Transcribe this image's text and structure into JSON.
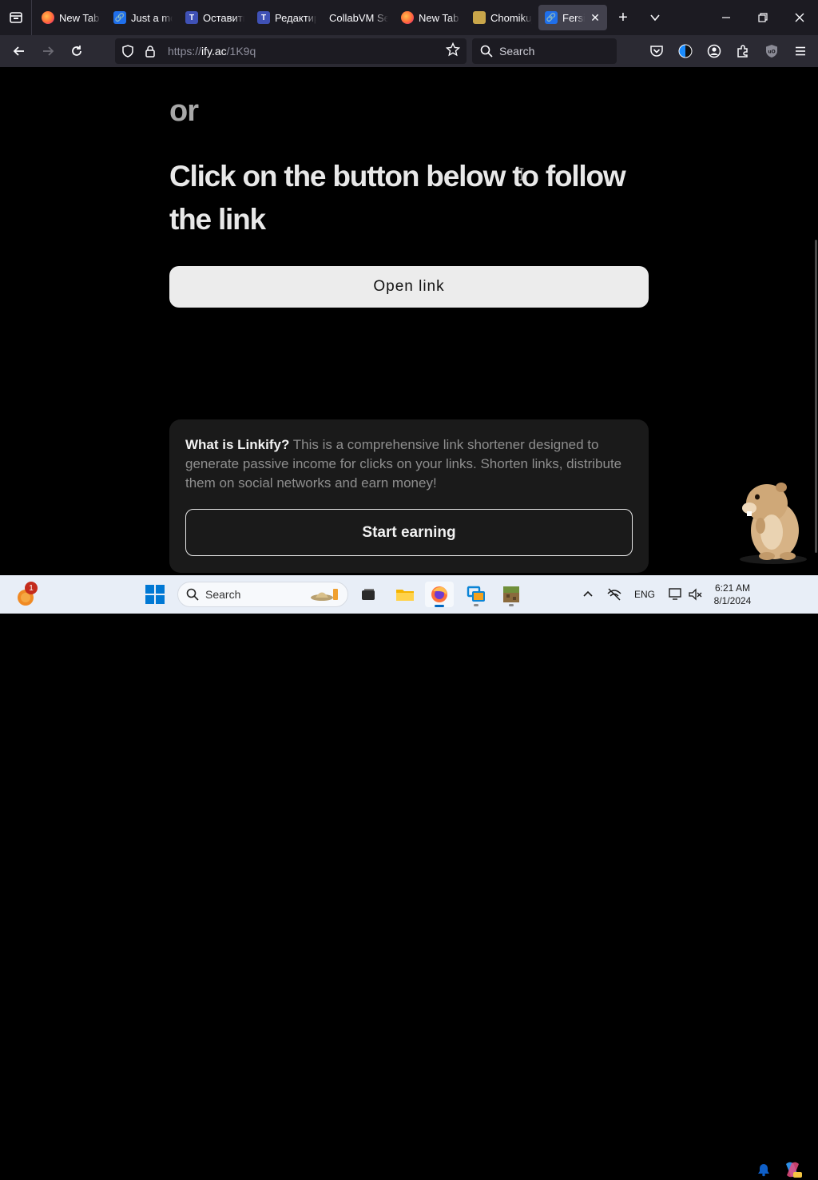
{
  "browser": {
    "tabs": [
      {
        "label": "New Tab",
        "favicon": "firefox-icon",
        "active": false
      },
      {
        "label": "Just a moment...",
        "favicon": "link-icon",
        "active": false
      },
      {
        "label": "Оставить",
        "favicon": "telegraph-icon",
        "active": false
      },
      {
        "label": "Редактир",
        "favicon": "telegraph-icon",
        "active": false
      },
      {
        "label": "CollabVM Se",
        "favicon": "none",
        "active": false
      },
      {
        "label": "New Tab",
        "favicon": "firefox-icon",
        "active": false
      },
      {
        "label": "Chomikuj",
        "favicon": "chomikuj-icon",
        "active": false
      },
      {
        "label": "Fersing",
        "favicon": "link-icon",
        "active": true
      }
    ],
    "url": {
      "scheme": "https://",
      "host": "ify.ac",
      "path": "/1K9q"
    },
    "search_placeholder": "Search"
  },
  "page": {
    "or_text": "or",
    "headline": "Click on the button below to follow the link",
    "open_link_label": "Open link",
    "info_question": "What is Linkify?",
    "info_body": " This is a comprehensive link shortener designed to generate passive income for clicks on your links. Shorten links, distribute them on social networks and earn money!",
    "start_earning_label": "Start earning"
  },
  "taskbar": {
    "notification_count": "1",
    "search_placeholder": "Search",
    "language": "ENG",
    "time": "6:21 AM",
    "date": "8/1/2024"
  },
  "colors": {
    "tabstrip": "#1c1b22",
    "navbar": "#2b2a33",
    "page_bg": "#000000",
    "open_button_bg": "#ececec",
    "card_bg": "#1a1a1a",
    "taskbar_bg": "#e8eef7",
    "accent": "#0078d4"
  }
}
